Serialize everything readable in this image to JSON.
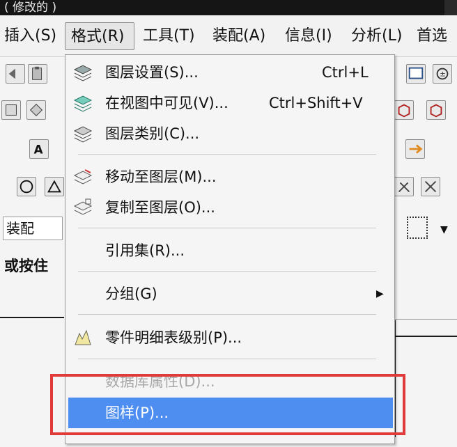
{
  "window": {
    "title_fragment": "( 修改的 )"
  },
  "menubar": {
    "items": [
      {
        "label": "插入(S)"
      },
      {
        "label": "格式(R)"
      },
      {
        "label": "工具(T)"
      },
      {
        "label": "装配(A)"
      },
      {
        "label": "信息(I)"
      },
      {
        "label": "分析(L)"
      },
      {
        "label": "首选"
      }
    ],
    "active_index": 1
  },
  "left_panel": {
    "assembly_field": "装配",
    "prompt_text": "或按住"
  },
  "format_menu": {
    "items": [
      {
        "label": "图层设置(S)...",
        "shortcut": "Ctrl+L",
        "icon": "layer-settings-icon"
      },
      {
        "label": "在视图中可见(V)...",
        "shortcut": "Ctrl+Shift+V",
        "icon": "visible-in-view-icon"
      },
      {
        "label": "图层类别(C)...",
        "shortcut": "",
        "icon": "layer-category-icon"
      },
      {
        "label": "移动至图层(M)...",
        "shortcut": "",
        "icon": "move-to-layer-icon"
      },
      {
        "label": "复制至图层(O)...",
        "shortcut": "",
        "icon": "copy-to-layer-icon"
      },
      {
        "label": "引用集(R)...",
        "shortcut": ""
      },
      {
        "label": "分组(G)",
        "shortcut": "",
        "submenu_arrow": "▶"
      },
      {
        "label": "零件明细表级别(P)...",
        "shortcut": "",
        "icon": "parts-list-level-icon"
      },
      {
        "label": "数据库属性(D)...",
        "shortcut": "",
        "disabled": true
      },
      {
        "label": "图样(P)...",
        "shortcut": "",
        "highlighted": true
      }
    ]
  },
  "colors": {
    "highlight": "#4d8ef0",
    "annotation_box": "#e03a3a",
    "menu_bg": "#f5f5f5"
  }
}
